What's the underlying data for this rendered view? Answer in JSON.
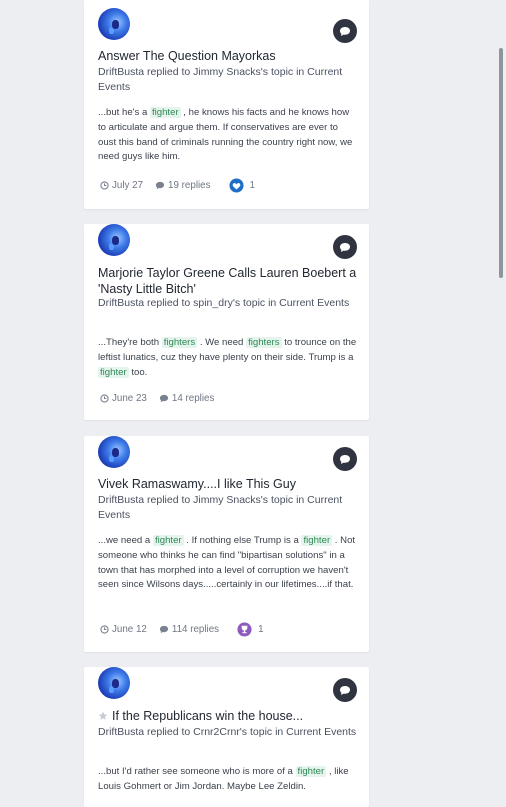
{
  "results": [
    {
      "title": "Answer The Question Mayorkas",
      "byline": "DriftBusta replied to Jimmy Snacks's topic in Current Events",
      "snippet": [
        "...but he's a ",
        "fighter",
        " , he knows his facts and he knows how to articulate and argue them. If conservatives are ever to oust this band of criminals running the country right now, we need guys like him."
      ],
      "date": "July 27",
      "replies": "19 replies",
      "reaction": {
        "type": "like-icon",
        "color": "#1f6fc9",
        "count": "1"
      }
    },
    {
      "title": "Marjorie Taylor Greene Calls Lauren Boebert a 'Nasty Little Bitch'",
      "byline": "DriftBusta replied to spin_dry's topic in Current Events",
      "snippet": [
        "...They're both ",
        "fighters",
        " . We need ",
        "fighters",
        "  to trounce on the leftist lunatics, cuz they have plenty on their side. Trump is a ",
        "fighter",
        "  too."
      ],
      "date": "June 23",
      "replies": "14 replies"
    },
    {
      "title": "Vivek Ramaswamy....I like This Guy",
      "byline": "DriftBusta replied to Jimmy Snacks's topic in Current Events",
      "snippet": [
        "...we need a ",
        "fighter",
        " . If nothing else Trump is a ",
        "fighter",
        " . Not someone who thinks he can find \"bipartisan solutions\" in a town that has morphed into a level of corruption we haven't seen since Wilsons days.....certainly in our lifetimes....if that."
      ],
      "date": "June 12",
      "replies": "114 replies",
      "reaction": {
        "type": "trophy-icon",
        "color": "#8e5bbd",
        "count": "1"
      }
    },
    {
      "title": "If the Republicans win the house...",
      "byline": "DriftBusta replied to Crnr2Crnr's topic in Current Events",
      "snippet": [
        "...but I'd rather see someone who is more of a ",
        "fighter",
        " , like Louis Gohmert or Jim Jordan. Maybe Lee Zeldin."
      ]
    }
  ]
}
